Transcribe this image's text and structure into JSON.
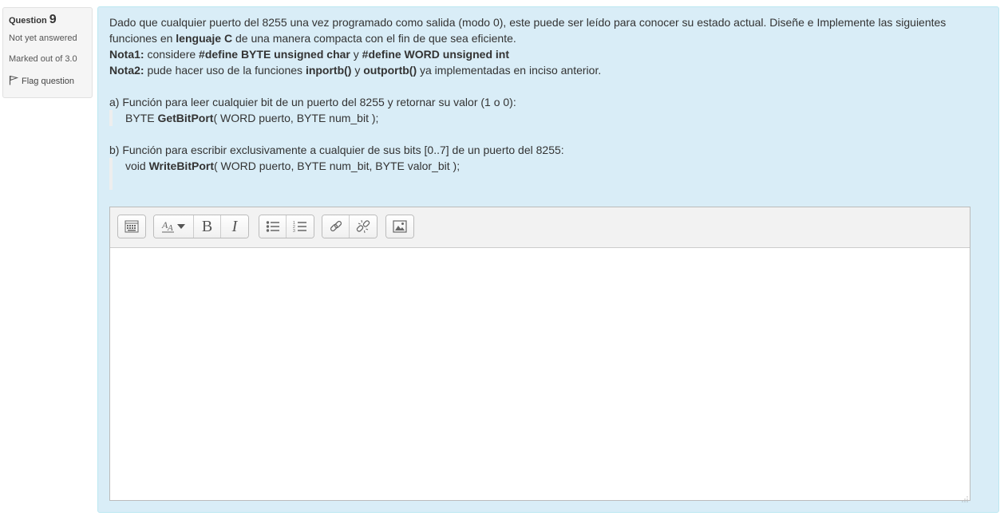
{
  "question_info": {
    "label": "Question",
    "number": "9",
    "state": "Not yet answered",
    "grade": "Marked out of 3.0",
    "flag_label": "Flag question"
  },
  "question": {
    "intro": "Dado que cualquier puerto del 8255 una vez programado como salida (modo 0), este puede ser leído para conocer su estado actual. Diseñe e Implemente las siguientes funciones en ",
    "intro_bold": "lenguaje C",
    "intro_end": " de una manera compacta con el fin de que sea eficiente.",
    "nota1_label": "Nota1:",
    "nota1_text": " considere ",
    "nota1_def1": "#define BYTE unsigned char",
    "nota1_and": " y ",
    "nota1_def2": "#define WORD unsigned int",
    "nota2_label": "Nota2:",
    "nota2_text": " pude hacer uso de la funciones ",
    "nota2_fn1": "inportb()",
    "nota2_and": " y ",
    "nota2_fn2": "outportb()",
    "nota2_end": " ya implementadas en inciso anterior.",
    "part_a": "a) Función para leer cualquier bit de un puerto del 8255 y retornar su valor (1 o 0):",
    "part_a_ret": "BYTE ",
    "part_a_fn": "GetBitPort",
    "part_a_args": "( WORD puerto, BYTE num_bit );",
    "part_b": "b) Función para escribir exclusivamente a cualquier de sus bits [0..7] de un puerto del 8255:",
    "part_b_ret": "void ",
    "part_b_fn": "WriteBitPort",
    "part_b_args": "( WORD puerto, BYTE num_bit, BYTE valor_bit );"
  },
  "editor": {
    "toolbar": [
      {
        "name": "show-more-buttons-icon"
      },
      {
        "name": "font-style-icon"
      },
      {
        "name": "bold-icon",
        "text": "B"
      },
      {
        "name": "italic-icon",
        "text": "I"
      },
      {
        "name": "unordered-list-icon"
      },
      {
        "name": "ordered-list-icon"
      },
      {
        "name": "link-icon"
      },
      {
        "name": "unlink-icon"
      },
      {
        "name": "image-icon"
      }
    ],
    "content": ""
  },
  "colors": {
    "content_bg": "#d9edf7",
    "content_border": "#bce8f1",
    "info_bg": "#f5f5f5"
  }
}
